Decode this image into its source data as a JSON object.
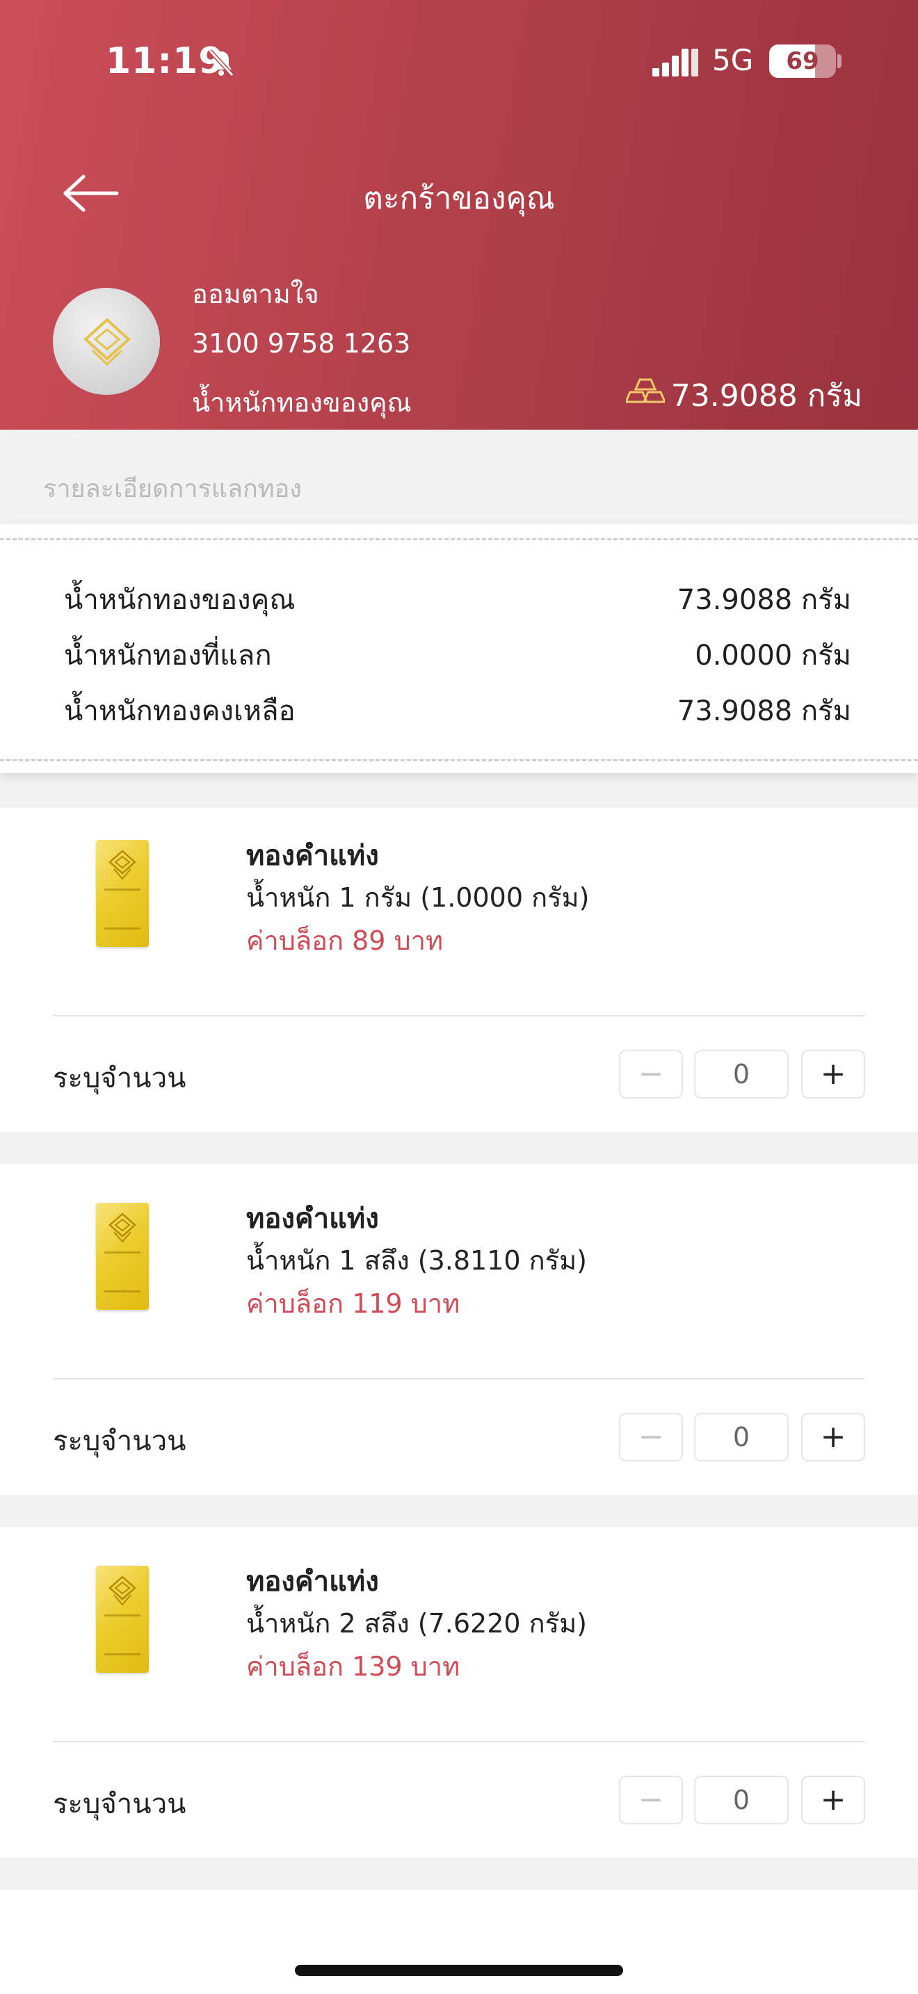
{
  "status_bar": {
    "time": "11:19",
    "network": "5G",
    "battery": "69",
    "battery_level": 0.69
  },
  "header": {
    "title": "ตะกร้าของคุณ",
    "account_name": "ออมตามใจ",
    "account_number": "3100 9758 1263",
    "gold_label": "น้ำหนักทองของคุณ",
    "gold_weight": "73.9088 กรัม"
  },
  "summary": {
    "section_title": "รายละเอียดการแลกทอง",
    "rows": [
      {
        "label": "น้ำหนักทองของคุณ",
        "value": "73.9088 กรัม"
      },
      {
        "label": "น้ำหนักทองที่แลก",
        "value": "0.0000 กรัม"
      },
      {
        "label": "น้ำหนักทองคงเหลือ",
        "value": "73.9088 กรัม"
      }
    ]
  },
  "products": [
    {
      "name": "ทองคำแท่ง",
      "weight": "น้ำหนัก 1 กรัม (1.0000 กรัม)",
      "fee": "ค่าบล็อก 89 บาท",
      "qty_label": "ระบุจำนวน",
      "quantity": "0",
      "minus": "−",
      "plus": "+"
    },
    {
      "name": "ทองคำแท่ง",
      "weight": "น้ำหนัก 1 สลึง (3.8110 กรัม)",
      "fee": "ค่าบล็อก 119 บาท",
      "qty_label": "ระบุจำนวน",
      "quantity": "0",
      "minus": "−",
      "plus": "+"
    },
    {
      "name": "ทองคำแท่ง",
      "weight": "น้ำหนัก 2 สลึง (7.6220 กรัม)",
      "fee": "ค่าบล็อก 139 บาท",
      "qty_label": "ระบุจำนวน",
      "quantity": "0",
      "minus": "−",
      "plus": "+"
    }
  ],
  "icons": {
    "back": "arrow-left-icon",
    "bell": "bell-slash-icon",
    "signal": "signal-icon",
    "gold": "gold-bars-icon",
    "avatar": "diamond-logo-icon",
    "bar_logo": "diamond-logo-icon"
  },
  "colors": {
    "header_start": "#cc4e5a",
    "header_end": "#98323d",
    "fee": "#cf4b56",
    "gold": "#eccd2e"
  }
}
